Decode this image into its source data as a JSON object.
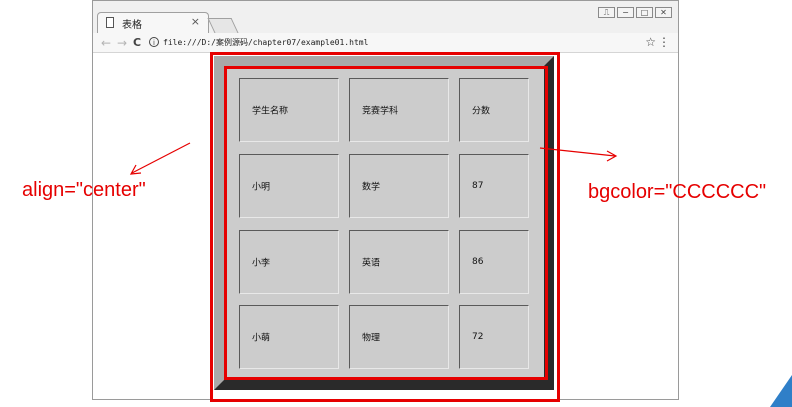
{
  "browser": {
    "tab_title": "表格",
    "tab_close": "×",
    "window_buttons": [
      "⎍",
      "−",
      "□",
      "✕"
    ],
    "url": "file:///D:/案例源码/chapter07/example01.html",
    "nav": {
      "back": "←",
      "forward": "→",
      "reload": "C"
    },
    "info_symbol": "i",
    "star": "☆",
    "menu": "⋮"
  },
  "table": {
    "bgcolor": "#CCCCCC",
    "rows": [
      [
        "学生名称",
        "竞赛学科",
        "分数"
      ],
      [
        "小明",
        "数学",
        "87"
      ],
      [
        "小李",
        "英语",
        "86"
      ],
      [
        "小萌",
        "物理",
        "72"
      ]
    ]
  },
  "annotations": {
    "left_label": "align=\"center\"",
    "right_label": "bgcolor=\"CCCCCC\""
  },
  "colors": {
    "annotation_red": "#e60000",
    "accent_blue": "#2f7fc8"
  }
}
